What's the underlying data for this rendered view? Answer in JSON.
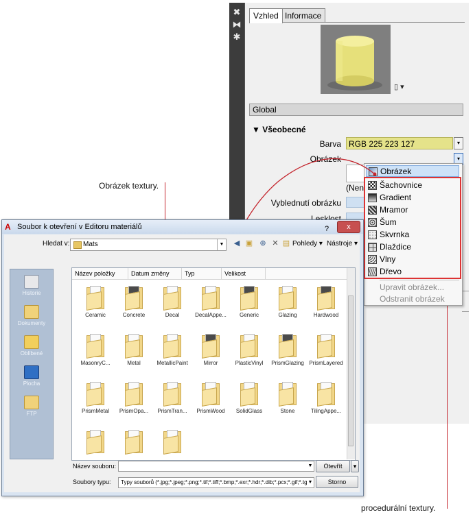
{
  "panel": {
    "tabs": [
      "Vzhled",
      "Informace"
    ],
    "global_label": "Global",
    "section_title": "Všeobecné",
    "section_arrow": "▼",
    "props": {
      "barva_label": "Barva",
      "barva_value": "RGB 225 223 127",
      "obrazek_label": "Obrázek",
      "obrazek_status": "(Neni",
      "vyblednuti_label": "Vyblednutí obrázku",
      "lesklost_label": "Lesklost"
    },
    "preview_object": "yellow-cylinder",
    "colors": {
      "swatch": "#e5e38a",
      "accent": "#c4262e"
    }
  },
  "menu": {
    "items": [
      {
        "label": "Obrázek",
        "icon": "image-icon",
        "state": "highlighted"
      },
      {
        "label": "Šachovnice",
        "icon": "checker-icon",
        "state": "normal"
      },
      {
        "label": "Gradient",
        "icon": "gradient-icon",
        "state": "normal"
      },
      {
        "label": "Mramor",
        "icon": "marble-icon",
        "state": "normal"
      },
      {
        "label": "Šum",
        "icon": "noise-icon",
        "state": "normal"
      },
      {
        "label": "Skvrnka",
        "icon": "speckle-icon",
        "state": "normal"
      },
      {
        "label": "Dlaždice",
        "icon": "tiles-icon",
        "state": "normal"
      },
      {
        "label": "Vlny",
        "icon": "waves-icon",
        "state": "normal"
      },
      {
        "label": "Dřevo",
        "icon": "wood-icon",
        "state": "normal"
      },
      {
        "label": "Upravit obrázek...",
        "state": "disabled"
      },
      {
        "label": "Odstranit obrázek",
        "state": "disabled"
      }
    ]
  },
  "callouts": {
    "top": "Obrázek textury.",
    "bottom": "procedurální textury."
  },
  "dialog": {
    "title": "Soubor k otevření v Editoru materiálů",
    "close_label": "x",
    "help_label": "?",
    "look_in_label": "Hledat v:",
    "look_in_value": "Mats",
    "views_label": "Pohledy",
    "tools_label": "Nástroje",
    "places": [
      "Historie",
      "Dokumenty",
      "Oblíbené",
      "Plocha",
      "FTP"
    ],
    "columns": [
      "Název položky",
      "Datum změny",
      "Typ",
      "Velikost"
    ],
    "folders": [
      {
        "name": "Ceramic",
        "dark": false
      },
      {
        "name": "Concrete",
        "dark": true
      },
      {
        "name": "Decal",
        "dark": false
      },
      {
        "name": "DecalAppe...",
        "dark": false
      },
      {
        "name": "Generic",
        "dark": true
      },
      {
        "name": "Glazing",
        "dark": false
      },
      {
        "name": "Hardwood",
        "dark": true
      },
      {
        "name": "MasonryC...",
        "dark": false
      },
      {
        "name": "Metal",
        "dark": false
      },
      {
        "name": "MetallicPaint",
        "dark": false
      },
      {
        "name": "Mirror",
        "dark": true
      },
      {
        "name": "PlasticVinyl",
        "dark": false
      },
      {
        "name": "PrismGlazing",
        "dark": true
      },
      {
        "name": "PrismLayered",
        "dark": false
      },
      {
        "name": "PrismMetal",
        "dark": false
      },
      {
        "name": "PrismOpa...",
        "dark": false
      },
      {
        "name": "PrismTran...",
        "dark": false
      },
      {
        "name": "PrismWood",
        "dark": false
      },
      {
        "name": "SolidGlass",
        "dark": false
      },
      {
        "name": "Stone",
        "dark": false
      },
      {
        "name": "TilingAppe...",
        "dark": false
      },
      {
        "name": "",
        "dark": false
      },
      {
        "name": "",
        "dark": false
      },
      {
        "name": "",
        "dark": false
      }
    ],
    "filename_label": "Název souboru:",
    "filetype_label": "Soubory typu:",
    "filetype_value": "Typy souborů  (*.jpg;*.jpeg;*.png;*.tif;*.tiff;*.bmp;*.exr;*.hdr;*.dib;*.pcx;*.gif;*.tga",
    "open_label": "Otevřít",
    "cancel_label": "Storno"
  }
}
